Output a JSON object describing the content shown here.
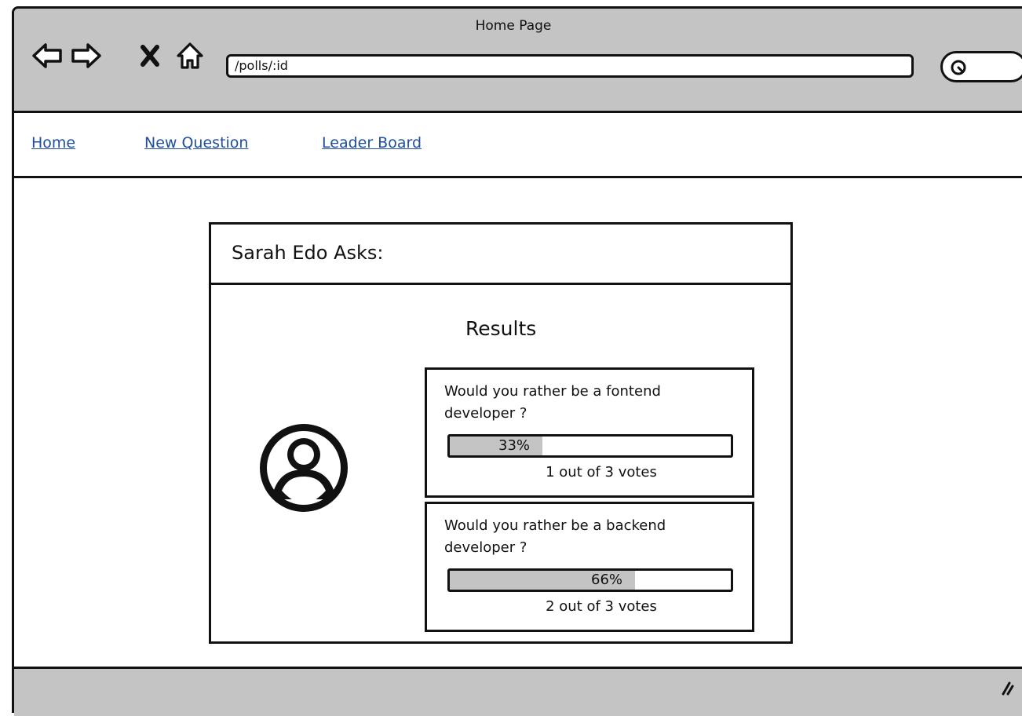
{
  "window": {
    "title": "Home Page"
  },
  "toolbar": {
    "url": "/polls/:id",
    "icons": [
      "back-arrow-icon",
      "forward-arrow-icon",
      "close-icon",
      "home-icon",
      "search-icon"
    ]
  },
  "nav": {
    "links": [
      "Home",
      "New Question",
      "Leader Board"
    ]
  },
  "poll": {
    "author_heading": "Sarah Edo Asks:",
    "results_title": "Results",
    "options": [
      {
        "text": "Would you rather be a fontend developer ?",
        "percent_label": "33%",
        "fraction": 0.33,
        "votes": "1 out of 3 votes"
      },
      {
        "text": "Would you rather be a backend developer ?",
        "percent_label": "66%",
        "fraction": 0.66,
        "votes": "2 out of 3 votes"
      }
    ]
  },
  "colors": {
    "chrome": "#c4c4c4",
    "link": "#1f4e9c",
    "bar_fill": "#c4c4c4"
  }
}
